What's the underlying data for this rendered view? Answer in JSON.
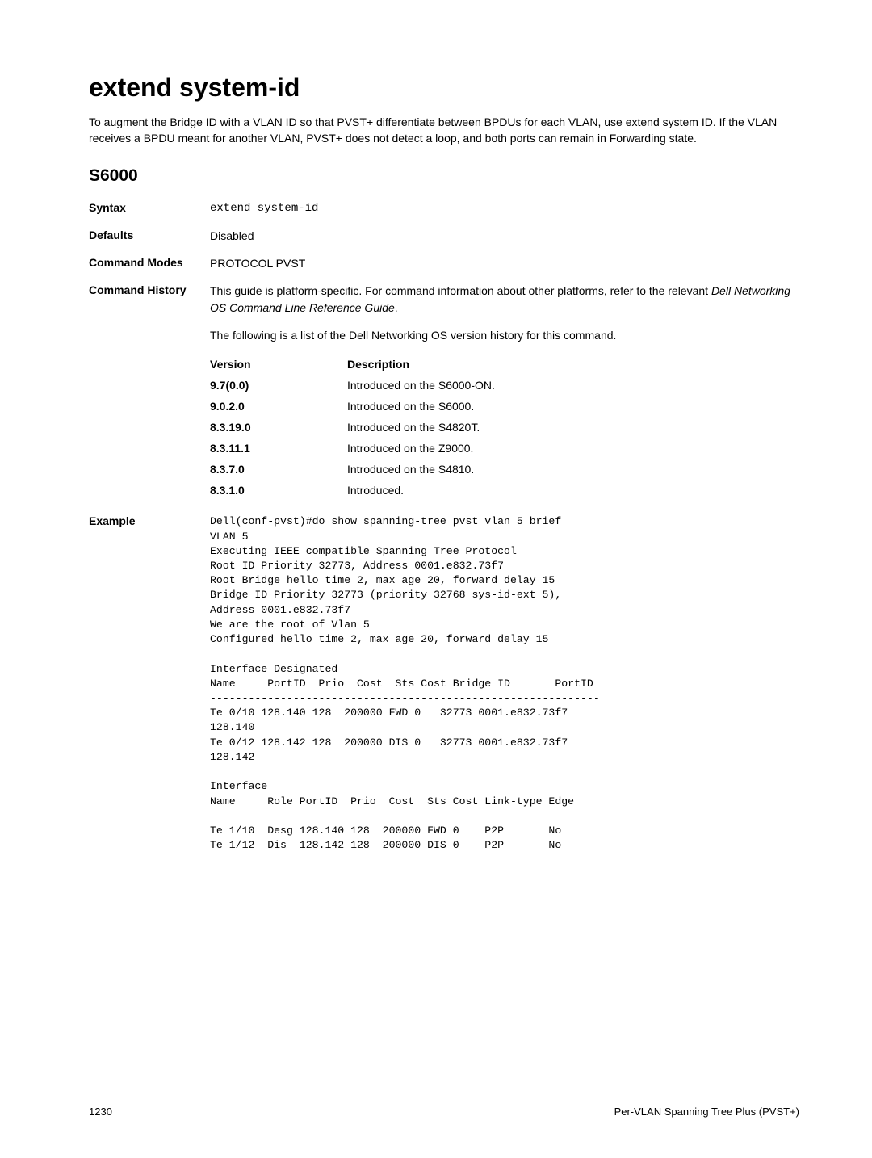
{
  "title": "extend system-id",
  "intro": "To augment the Bridge ID with a VLAN ID so that PVST+ differentiate between BPDUs for each VLAN, use extend system ID. If the VLAN receives a BPDU meant for another VLAN, PVST+ does not detect a loop, and both ports can remain in Forwarding state.",
  "subheading": "S6000",
  "syntax": {
    "label": "Syntax",
    "value": "extend system-id"
  },
  "defaults": {
    "label": "Defaults",
    "value": "Disabled"
  },
  "modes": {
    "label": "Command Modes",
    "value": "PROTOCOL PVST"
  },
  "history": {
    "label": "Command History",
    "para1_a": "This guide is platform-specific. For command information about other platforms, refer to the relevant ",
    "para1_b": "Dell Networking OS Command Line Reference Guide",
    "para1_c": ".",
    "para2": "The following is a list of the Dell Networking OS version history for this command."
  },
  "versionHeader": {
    "c1": "Version",
    "c2": "Description"
  },
  "versions": [
    {
      "v": "9.7(0.0)",
      "d": "Introduced on the S6000-ON."
    },
    {
      "v": "9.0.2.0",
      "d": "Introduced on the S6000."
    },
    {
      "v": "8.3.19.0",
      "d": "Introduced on the S4820T."
    },
    {
      "v": "8.3.11.1",
      "d": "Introduced on the Z9000."
    },
    {
      "v": "8.3.7.0",
      "d": "Introduced on the S4810."
    },
    {
      "v": "8.3.1.0",
      "d": "Introduced."
    }
  ],
  "example": {
    "label": "Example",
    "text": "Dell(conf-pvst)#do show spanning-tree pvst vlan 5 brief\nVLAN 5\nExecuting IEEE compatible Spanning Tree Protocol\nRoot ID Priority 32773, Address 0001.e832.73f7\nRoot Bridge hello time 2, max age 20, forward delay 15\nBridge ID Priority 32773 (priority 32768 sys-id-ext 5),\nAddress 0001.e832.73f7\nWe are the root of Vlan 5\nConfigured hello time 2, max age 20, forward delay 15\n\nInterface Designated\nName     PortID  Prio  Cost  Sts Cost Bridge ID       PortID\n-------------------------------------------------------------\nTe 0/10 128.140 128  200000 FWD 0   32773 0001.e832.73f7  \n128.140\nTe 0/12 128.142 128  200000 DIS 0   32773 0001.e832.73f7  \n128.142\n\nInterface\nName     Role PortID  Prio  Cost  Sts Cost Link-type Edge\n--------------------------------------------------------\nTe 1/10  Desg 128.140 128  200000 FWD 0    P2P       No\nTe 1/12  Dis  128.142 128  200000 DIS 0    P2P       No"
  },
  "footer": {
    "left": "1230",
    "right": "Per-VLAN Spanning Tree Plus (PVST+)"
  }
}
